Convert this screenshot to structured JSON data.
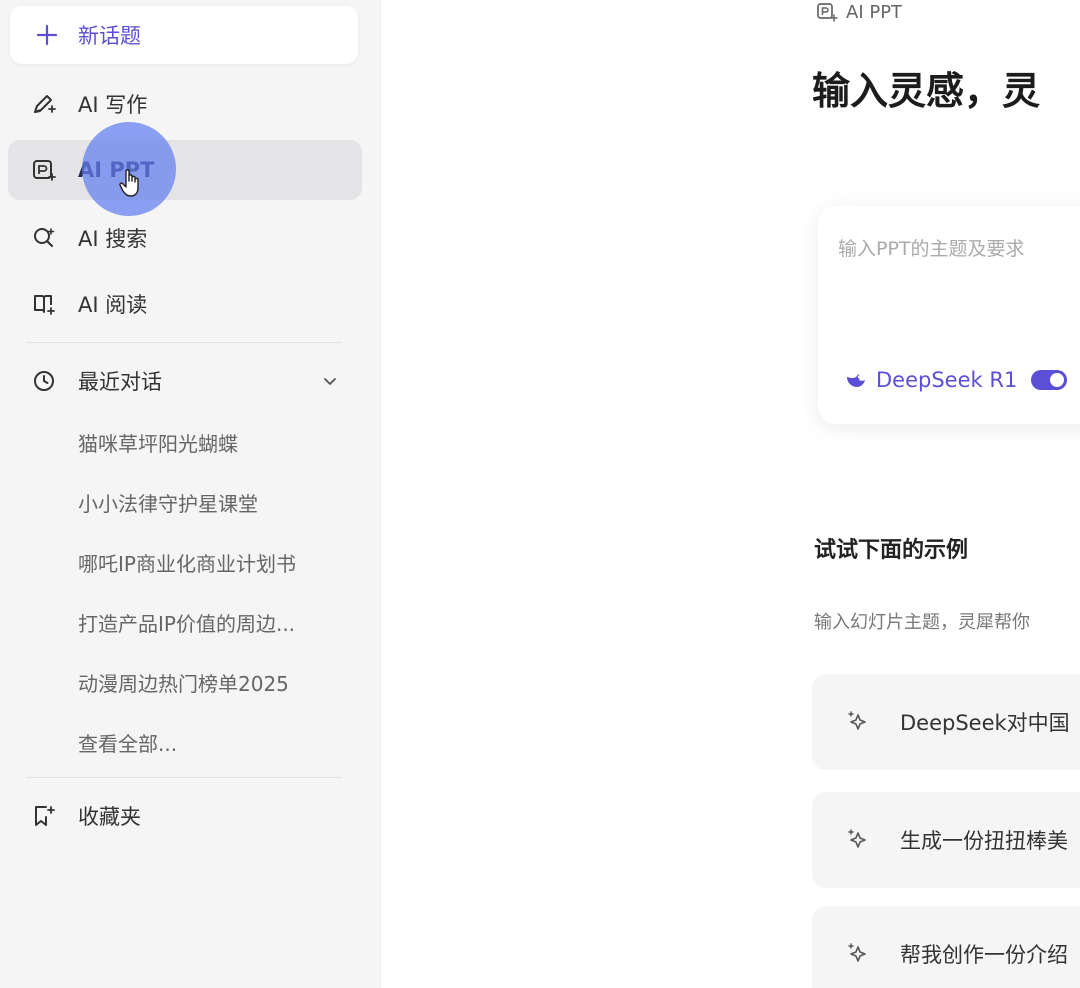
{
  "sidebar": {
    "new_topic": "新话题",
    "nav": [
      {
        "label": "AI 写作",
        "icon": "pen-sparkle-icon"
      },
      {
        "label": "AI PPT",
        "icon": "ppt-icon",
        "active": true
      },
      {
        "label": "AI 搜索",
        "icon": "search-icon"
      },
      {
        "label": "AI 阅读",
        "icon": "book-icon"
      }
    ],
    "recent": {
      "title": "最近对话",
      "items": [
        "猫咪草坪阳光蝴蝶",
        "小小法律守护星课堂",
        "哪吒IP商业化商业计划书",
        "打造产品IP价值的周边...",
        "动漫周边热门榜单2025"
      ],
      "view_all": "查看全部..."
    },
    "favorites": "收藏夹"
  },
  "main": {
    "breadcrumb": "AI PPT",
    "headline": "输入灵感，灵",
    "input": {
      "placeholder": "输入PPT的主题及要求",
      "model": "DeepSeek R1"
    },
    "examples": {
      "title": "试试下面的示例",
      "description": "输入幻灯片主题，灵犀帮你",
      "items": [
        "DeepSeek对中国",
        "生成一份扭扭棒美",
        "帮我创作一份介绍"
      ]
    }
  },
  "colors": {
    "accent": "#5b4fd6",
    "sidebar_bg": "#f5f5f6",
    "active_bg": "#e4e4e6",
    "click_halo": "#627ef0"
  }
}
